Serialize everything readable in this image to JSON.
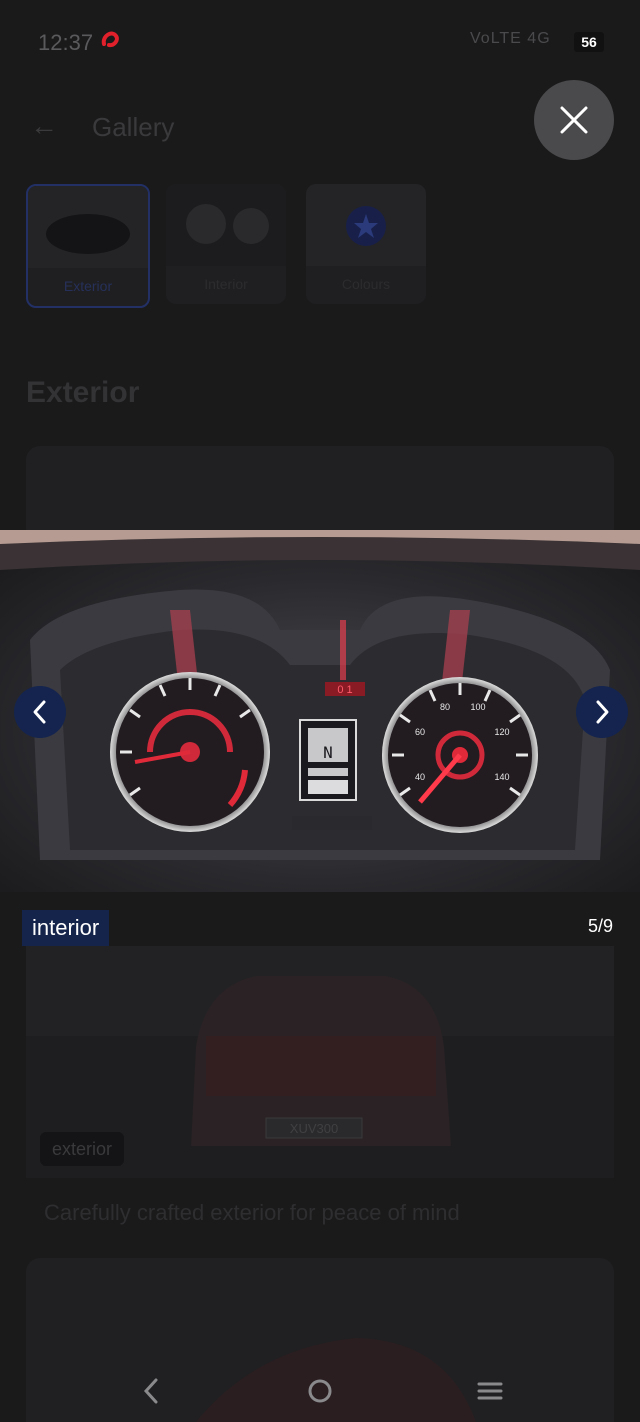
{
  "status_bar": {
    "time": "12:37",
    "signal_text": "VoLTE 4G",
    "battery": "56"
  },
  "header": {
    "title": "Gallery"
  },
  "tabs": [
    {
      "label": "Exterior"
    },
    {
      "label": "Interior"
    },
    {
      "label": "Colours"
    }
  ],
  "section": {
    "title": "Exterior"
  },
  "viewer": {
    "caption": "interior",
    "counter": "5/9"
  },
  "background_card": {
    "chip": "exterior",
    "plate": "XUV300",
    "description": "Carefully crafted exterior for peace of mind"
  },
  "colors": {
    "nav_button": "#14244e",
    "caption_bg": "#15244a",
    "close_bg": "#4a4a4c"
  },
  "icons": {
    "back": "arrow-left-icon",
    "close": "close-icon",
    "prev": "chevron-left-icon",
    "next": "chevron-right-icon"
  }
}
